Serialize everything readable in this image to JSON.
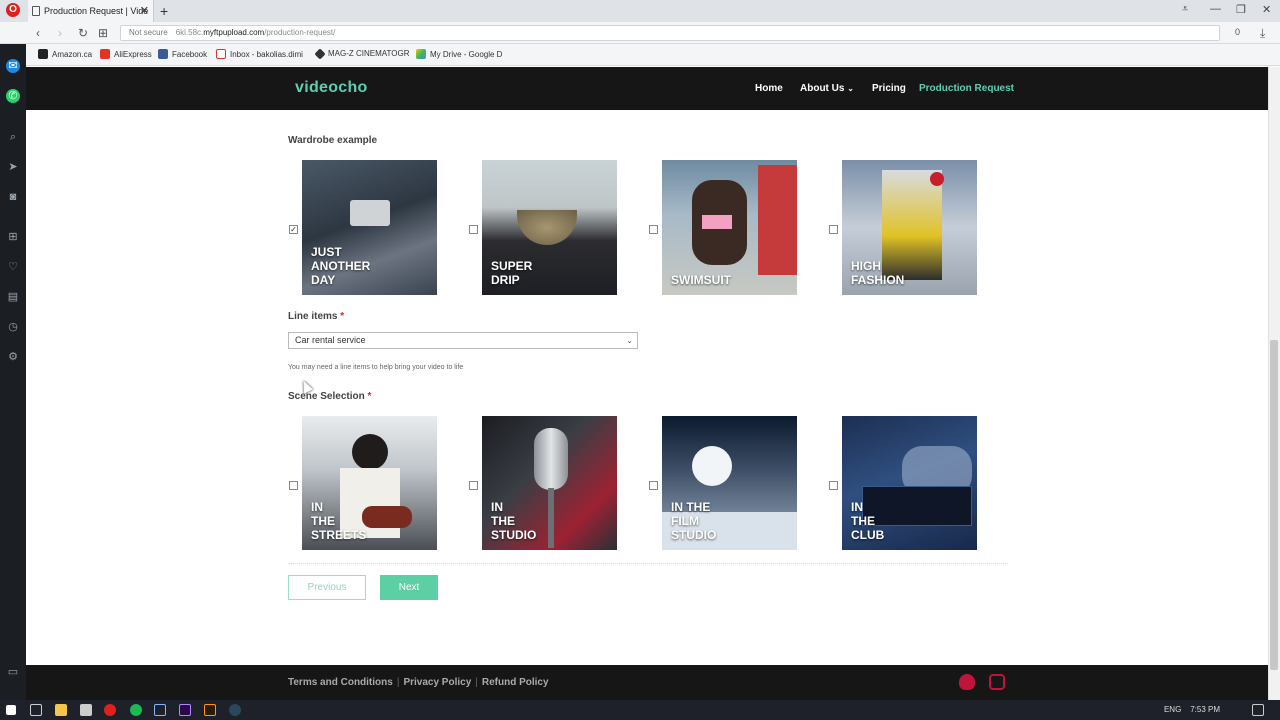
{
  "browser": {
    "tab_title": "Production Request | Vide",
    "url_prefix": "Not secure",
    "url_grey": "6kl.58c.",
    "url_host": "myftpupload.com",
    "url_path": "/production-request/",
    "url_right": "0",
    "bookmarks": [
      "Amazon.ca",
      "AliExpress",
      "Facebook",
      "Inbox - bakolias.dimi",
      "MAG-Z CINEMATOGR",
      "My Drive - Google D"
    ]
  },
  "site": {
    "brand": "videocho",
    "nav": [
      "Home",
      "About Us",
      "Pricing",
      "Production Request"
    ],
    "nav_active_index": 3,
    "accent_color": "#5ccfb0"
  },
  "form": {
    "wardrobe_label": "Wardrobe example",
    "wardrobe_options": [
      {
        "caption": "JUST\nANOTHER\nDAY",
        "checked": true
      },
      {
        "caption": "SUPER\nDRIP",
        "checked": false
      },
      {
        "caption": "SWIMSUIT",
        "checked": false
      },
      {
        "caption": "HIGH\nFASHION",
        "checked": false
      }
    ],
    "line_items_label": "Line items",
    "required_mark": "*",
    "line_items_value": "Car rental service",
    "line_items_hint": "You may need a line items to help bring your video to life",
    "scene_label": "Scene Selection",
    "scene_options": [
      {
        "caption": "IN\nTHE\nSTREETS",
        "checked": false
      },
      {
        "caption": "IN\nTHE\nSTUDIO",
        "checked": false
      },
      {
        "caption": "IN THE\nFILM\nSTUDIO",
        "checked": false
      },
      {
        "caption": "IN\nTHE\nCLUB",
        "checked": false
      }
    ],
    "prev_label": "Previous",
    "next_label": "Next"
  },
  "footer": {
    "links": [
      "Terms and Conditions",
      "Privacy Policy",
      "Refund Policy"
    ],
    "social_icons": [
      "snapchat-icon",
      "instagram-icon"
    ]
  },
  "taskbar": {
    "lang": "ENG",
    "time": "7:53 PM"
  }
}
